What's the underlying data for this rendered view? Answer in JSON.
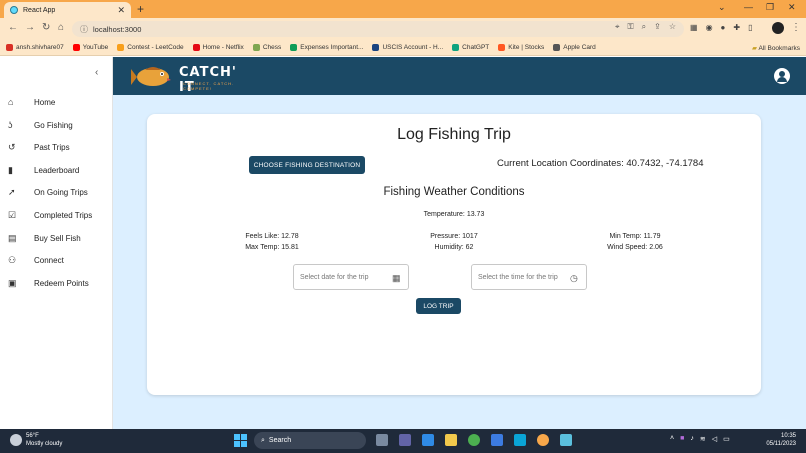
{
  "browser": {
    "tab_title": "React App",
    "url": "localhost:3000",
    "all_bookmarks": "All Bookmarks",
    "bookmarks": [
      {
        "label": "ansh.shivhare07",
        "icon": "gmail-icon",
        "color": "#d93025"
      },
      {
        "label": "YouTube",
        "icon": "youtube-icon",
        "color": "#ff0000"
      },
      {
        "label": "Contest - LeetCode",
        "icon": "leetcode-icon",
        "color": "#f89f1b"
      },
      {
        "label": "Home - Netflix",
        "icon": "netflix-icon",
        "color": "#e50914"
      },
      {
        "label": "Chess",
        "icon": "chess-icon",
        "color": "#7fa650"
      },
      {
        "label": "Expenses Important...",
        "icon": "sheets-icon",
        "color": "#0f9d58"
      },
      {
        "label": "USCIS Account - H...",
        "icon": "uscis-icon",
        "color": "#1a4480"
      },
      {
        "label": "ChatGPT",
        "icon": "chatgpt-icon",
        "color": "#10a37f"
      },
      {
        "label": "Kite | Stocks",
        "icon": "kite-icon",
        "color": "#ff5722"
      },
      {
        "label": "Apple Card",
        "icon": "apple-icon",
        "color": "#555555"
      }
    ]
  },
  "app": {
    "logo_title": "CATCH' IT",
    "logo_tagline": "CONNECT. CATCH. COMPETE!",
    "sidebar": [
      {
        "label": "Home",
        "icon": "home-icon",
        "glyph": "⌂"
      },
      {
        "label": "Go Fishing",
        "icon": "fishing-hook-icon",
        "glyph": "ʖ"
      },
      {
        "label": "Past Trips",
        "icon": "history-icon",
        "glyph": "↺"
      },
      {
        "label": "Leaderboard",
        "icon": "bar-chart-icon",
        "glyph": "▮"
      },
      {
        "label": "On Going Trips",
        "icon": "rocket-icon",
        "glyph": "➚"
      },
      {
        "label": "Completed Trips",
        "icon": "checklist-icon",
        "glyph": "☑"
      },
      {
        "label": "Buy Sell Fish",
        "icon": "store-icon",
        "glyph": "▤"
      },
      {
        "label": "Connect",
        "icon": "connect-icon",
        "glyph": "⚇"
      },
      {
        "label": "Redeem Points",
        "icon": "redeem-icon",
        "glyph": "▣"
      }
    ],
    "page_title": "Log Fishing Trip",
    "choose_destination": "CHOOSE FISHING DESTINATION",
    "coordinates": "Current Location Coordinates: 40.7432, -74.1784",
    "weather_title": "Fishing Weather Conditions",
    "temperature": "Temperature: 13.73",
    "weather": {
      "feels_like": "Feels Like: 12.78",
      "max_temp": "Max Temp: 15.81",
      "pressure": "Pressure: 1017",
      "humidity": "Humidity: 62",
      "min_temp": "Min Temp: 11.79",
      "wind_speed": "Wind Speed: 2.06"
    },
    "date_placeholder": "Select date for the trip",
    "time_placeholder": "Select the time for the trip",
    "log_trip": "LOG TRIP"
  },
  "taskbar": {
    "weather_temp": "56°F",
    "weather_desc": "Mostly cloudy",
    "search": "Search",
    "time": "10:35",
    "date": "05/11/2023"
  },
  "colors": {
    "titlebar": "#f7a74a",
    "appbar": "#1b4965",
    "main_bg": "#dcefff"
  }
}
